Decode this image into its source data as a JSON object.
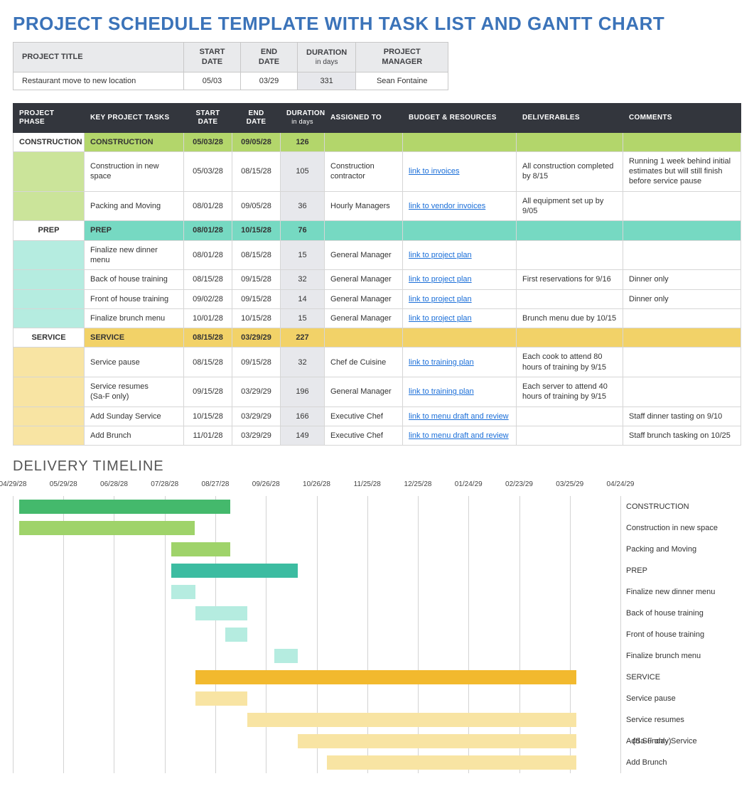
{
  "title": "PROJECT SCHEDULE TEMPLATE WITH TASK LIST AND GANTT CHART",
  "info": {
    "headers": {
      "project_title": "PROJECT TITLE",
      "start_date": "START DATE",
      "end_date": "END DATE",
      "duration": "DURATION",
      "duration_sub": "in days",
      "project_manager": "PROJECT MANAGER"
    },
    "project_title": "Restaurant move to new location",
    "start_date": "05/03",
    "end_date": "03/29",
    "duration": "331",
    "project_manager": "Sean Fontaine"
  },
  "task_headers": {
    "phase": "PROJECT PHASE",
    "key_tasks": "KEY PROJECT TASKS",
    "start": "START DATE",
    "end": "END DATE",
    "duration": "DURATION",
    "duration_sub": "in days",
    "assigned": "ASSIGNED TO",
    "budget": "BUDGET & RESOURCES",
    "deliverables": "DELIVERABLES",
    "comments": "COMMENTS"
  },
  "rows": [
    {
      "type": "phase",
      "color": "construction",
      "phase": "CONSTRUCTION",
      "task": "CONSTRUCTION",
      "start": "05/03/28",
      "end": "09/05/28",
      "duration": "126",
      "assigned": "",
      "budget": "",
      "budget_link": false,
      "deliverables": "",
      "comments": ""
    },
    {
      "type": "task",
      "color": "construction",
      "phase": "",
      "task": "Construction in new space",
      "start": "05/03/28",
      "end": "08/15/28",
      "duration": "105",
      "assigned": "Construction contractor",
      "budget": "link to invoices",
      "budget_link": true,
      "deliverables": "All construction completed by 8/15",
      "comments": "Running 1 week behind initial estimates but will still finish before service pause"
    },
    {
      "type": "task",
      "color": "construction",
      "phase": "",
      "task": "Packing and Moving",
      "start": "08/01/28",
      "end": "09/05/28",
      "duration": "36",
      "assigned": "Hourly Managers",
      "budget": "link to vendor invoices",
      "budget_link": true,
      "deliverables": "All equipment set up by 9/05",
      "comments": ""
    },
    {
      "type": "phase",
      "color": "prep",
      "phase": "PREP",
      "task": "PREP",
      "start": "08/01/28",
      "end": "10/15/28",
      "duration": "76",
      "assigned": "",
      "budget": "",
      "budget_link": false,
      "deliverables": "",
      "comments": ""
    },
    {
      "type": "task",
      "color": "prep",
      "phase": "",
      "task": "Finalize new dinner menu",
      "start": "08/01/28",
      "end": "08/15/28",
      "duration": "15",
      "assigned": "General Manager",
      "budget": "link to project plan",
      "budget_link": true,
      "deliverables": "",
      "comments": ""
    },
    {
      "type": "task",
      "color": "prep",
      "phase": "",
      "task": "Back of house training",
      "start": "08/15/28",
      "end": "09/15/28",
      "duration": "32",
      "assigned": "General Manager",
      "budget": "link to project plan",
      "budget_link": true,
      "deliverables": "First reservations for 9/16",
      "comments": "Dinner only"
    },
    {
      "type": "task",
      "color": "prep",
      "phase": "",
      "task": "Front of house training",
      "start": "09/02/28",
      "end": "09/15/28",
      "duration": "14",
      "assigned": "General Manager",
      "budget": "link to project plan",
      "budget_link": true,
      "deliverables": "",
      "comments": "Dinner only"
    },
    {
      "type": "task",
      "color": "prep",
      "phase": "",
      "task": "Finalize brunch menu",
      "start": "10/01/28",
      "end": "10/15/28",
      "duration": "15",
      "assigned": "General Manager",
      "budget": "link to project plan",
      "budget_link": true,
      "deliverables": "Brunch menu due by 10/15",
      "comments": ""
    },
    {
      "type": "phase",
      "color": "service",
      "phase": "SERVICE",
      "task": "SERVICE",
      "start": "08/15/28",
      "end": "03/29/29",
      "duration": "227",
      "assigned": "",
      "budget": "",
      "budget_link": false,
      "deliverables": "",
      "comments": ""
    },
    {
      "type": "task",
      "color": "service",
      "phase": "",
      "task": "Service pause",
      "start": "08/15/28",
      "end": "09/15/28",
      "duration": "32",
      "assigned": "Chef de Cuisine",
      "budget": "link to training plan",
      "budget_link": true,
      "deliverables": "Each cook to attend 80 hours of training by 9/15",
      "comments": ""
    },
    {
      "type": "task",
      "color": "service",
      "phase": "",
      "task": "Service resumes\n(Sa-F only)",
      "start": "09/15/28",
      "end": "03/29/29",
      "duration": "196",
      "assigned": "General Manager",
      "budget": "link to training plan",
      "budget_link": true,
      "deliverables": "Each server to attend 40 hours of training by 9/15",
      "comments": ""
    },
    {
      "type": "task",
      "color": "service",
      "phase": "",
      "task": "Add Sunday Service",
      "start": "10/15/28",
      "end": "03/29/29",
      "duration": "166",
      "assigned": "Executive Chef",
      "budget": "link to menu draft and review",
      "budget_link": true,
      "deliverables": "",
      "comments": "Staff dinner tasting on 9/10"
    },
    {
      "type": "task",
      "color": "service",
      "phase": "",
      "task": "Add Brunch",
      "start": "11/01/28",
      "end": "03/29/29",
      "duration": "149",
      "assigned": "Executive Chef",
      "budget": "link to menu draft and review",
      "budget_link": true,
      "deliverables": "",
      "comments": "Staff brunch tasking on 10/25"
    }
  ],
  "timeline_title": "DELIVERY TIMELINE",
  "chart_data": {
    "type": "gantt",
    "title": "DELIVERY TIMELINE",
    "x_range": [
      "04/29/28",
      "04/24/29"
    ],
    "ticks": [
      "04/29/28",
      "05/29/28",
      "06/28/28",
      "07/28/28",
      "08/27/28",
      "09/26/28",
      "10/26/28",
      "11/25/28",
      "12/25/28",
      "01/24/29",
      "02/23/29",
      "03/25/29",
      "04/24/29"
    ],
    "tasks": [
      {
        "label": "CONSTRUCTION",
        "start": "05/03/28",
        "end": "09/05/28",
        "bar_class": "bar-construction"
      },
      {
        "label": "Construction in new space",
        "start": "05/03/28",
        "end": "08/15/28",
        "bar_class": "bar-construction-light"
      },
      {
        "label": "Packing and Moving",
        "start": "08/01/28",
        "end": "09/05/28",
        "bar_class": "bar-construction-light"
      },
      {
        "label": "PREP",
        "start": "08/01/28",
        "end": "10/15/28",
        "bar_class": "bar-prep"
      },
      {
        "label": "Finalize new dinner menu",
        "start": "08/01/28",
        "end": "08/15/28",
        "bar_class": "bar-prep-light"
      },
      {
        "label": "Back of house training",
        "start": "08/15/28",
        "end": "09/15/28",
        "bar_class": "bar-prep-light"
      },
      {
        "label": "Front of house training",
        "start": "09/02/28",
        "end": "09/15/28",
        "bar_class": "bar-prep-light"
      },
      {
        "label": "Finalize brunch menu",
        "start": "10/01/28",
        "end": "10/15/28",
        "bar_class": "bar-prep-light"
      },
      {
        "label": "SERVICE",
        "start": "08/15/28",
        "end": "03/29/29",
        "bar_class": "bar-service"
      },
      {
        "label": "Service pause",
        "start": "08/15/28",
        "end": "09/15/28",
        "bar_class": "bar-service-light"
      },
      {
        "label": "Service resumes\n   (Sa-F only)",
        "start": "09/15/28",
        "end": "03/29/29",
        "bar_class": "bar-service-light"
      },
      {
        "label": "Add Sunday Service",
        "start": "10/15/28",
        "end": "03/29/29",
        "bar_class": "bar-service-light"
      },
      {
        "label": "Add Brunch",
        "start": "11/01/28",
        "end": "03/29/29",
        "bar_class": "bar-service-light"
      }
    ]
  }
}
